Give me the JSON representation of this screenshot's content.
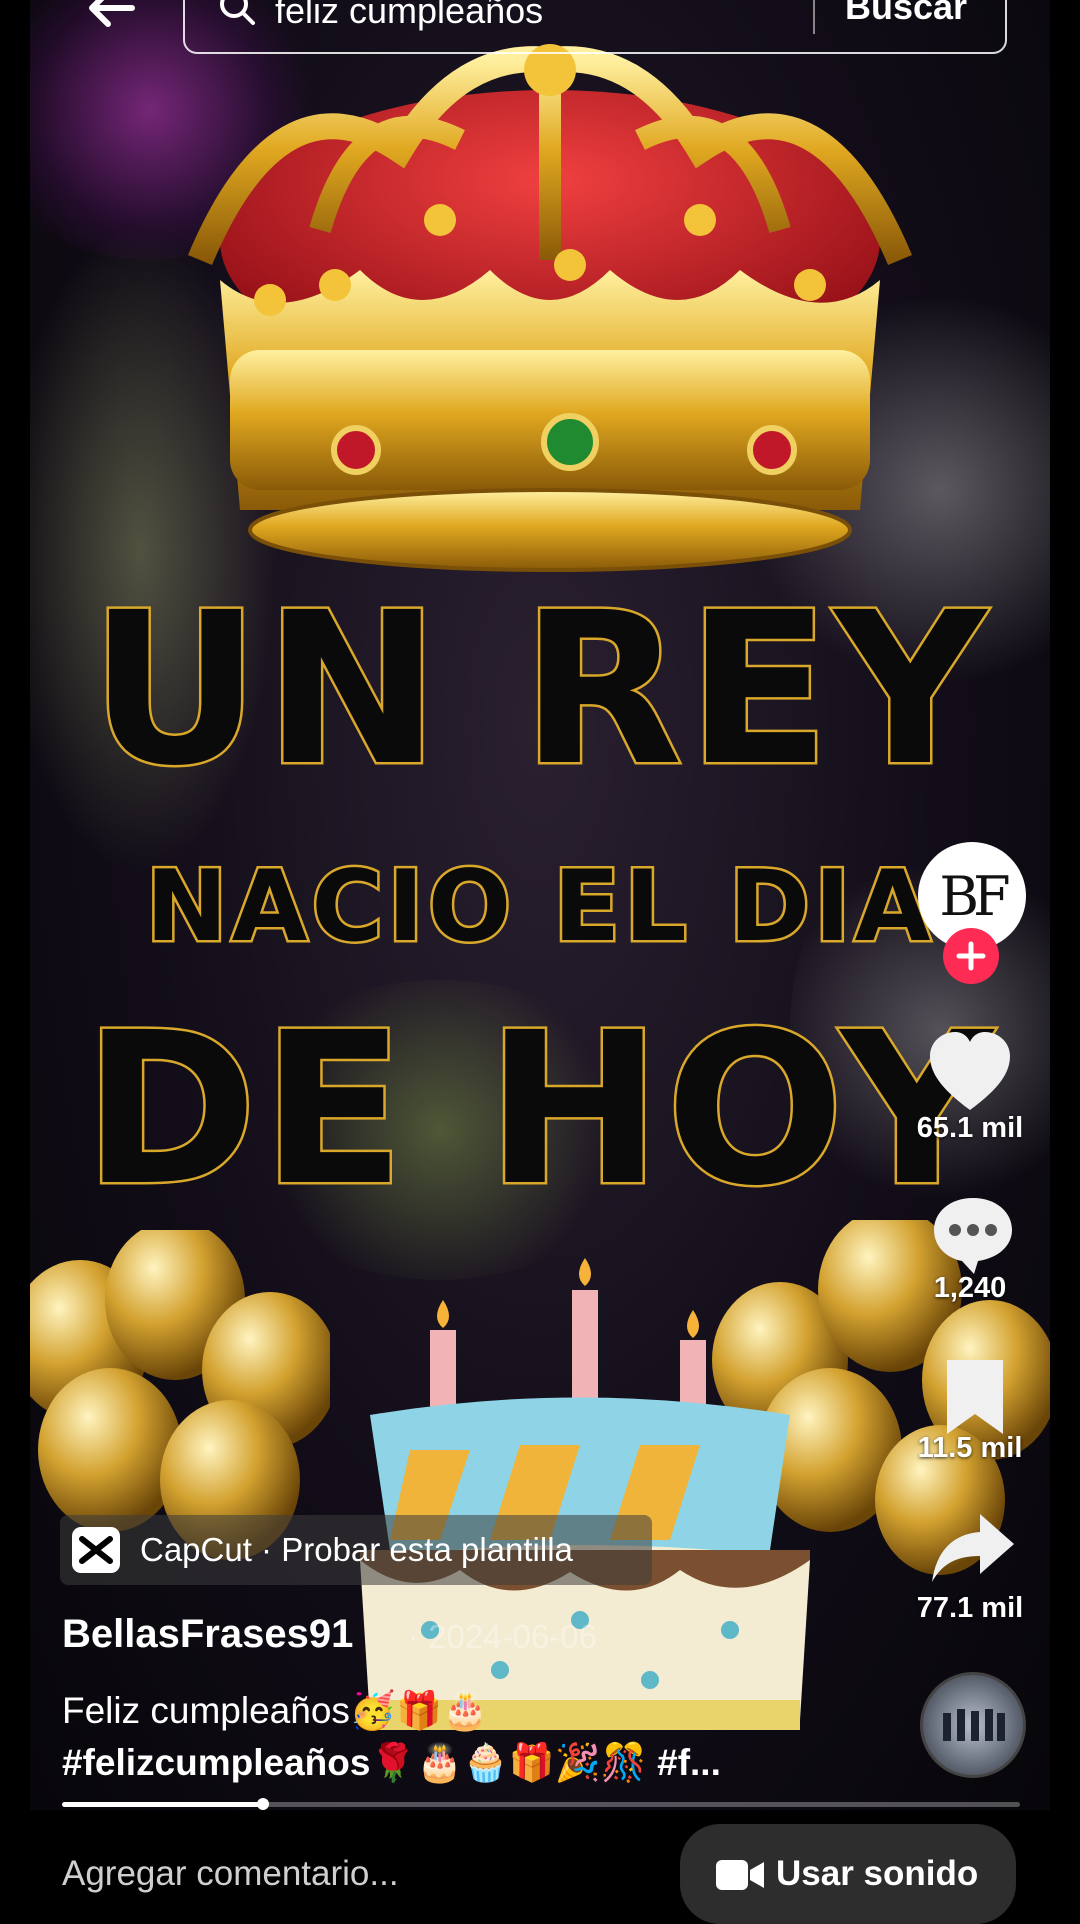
{
  "search": {
    "query": "feliz cumpleaños",
    "button_label": "Buscar"
  },
  "video": {
    "title_lines": [
      "UN REY",
      "NACIO EL DIA",
      "DE HOY"
    ],
    "avatar_initials": "BF"
  },
  "actions": {
    "likes": "65.1 mil",
    "comments": "1,240",
    "saves": "11.5 mil",
    "shares": "77.1 mil"
  },
  "template_banner": {
    "label": "CapCut · Probar esta plantilla"
  },
  "post": {
    "author": "BellasFrases91",
    "date": "· 2024-06-06",
    "caption_line1": "Feliz cumpleaños🥳🎁🎂",
    "caption_line2": "#felizcumpleaños🌹🎂🧁🎁🎉🎊 #f..."
  },
  "playback": {
    "progress_fraction": 0.21
  },
  "bottom": {
    "comment_placeholder": "Agregar comentario...",
    "use_sound_label": "Usar sonido"
  },
  "colors": {
    "accent_pink": "#fe2c55",
    "gold": "#d9a82b"
  }
}
